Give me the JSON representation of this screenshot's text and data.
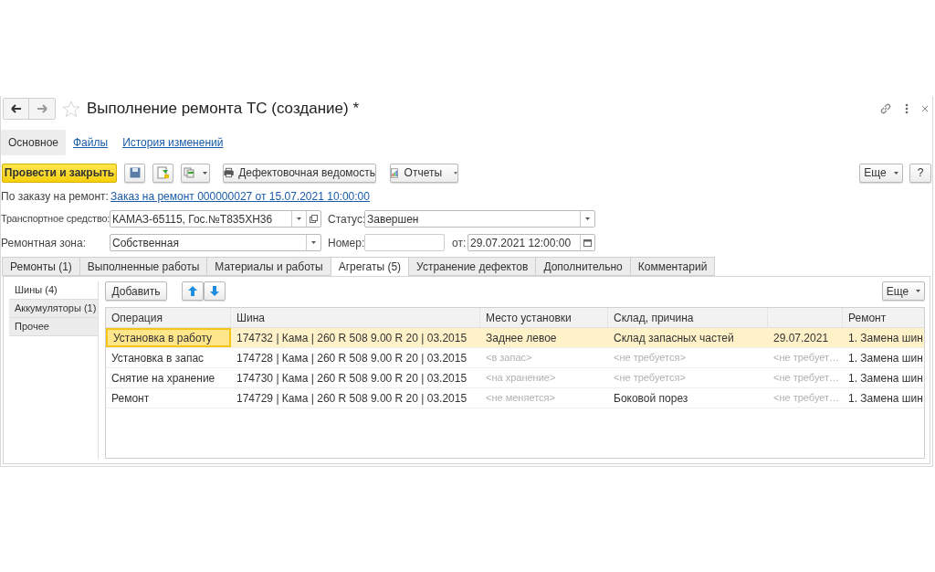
{
  "window": {
    "title": "Выполнение ремонта ТС (создание) *"
  },
  "nav_tabs": [
    {
      "label": "Основное",
      "selected": true
    },
    {
      "label": "Файлы",
      "selected": false
    },
    {
      "label": "История изменений",
      "selected": false
    }
  ],
  "toolbar": {
    "post_button": "Провести и закрыть",
    "print_button": "Дефектовочная ведомость",
    "reports_button": "Отчеты",
    "more_button": "Еще",
    "help_button": "?"
  },
  "order": {
    "label": "По заказу на ремонт:",
    "link": "Заказ на ремонт 000000027 от 15.07.2021 10:00:00"
  },
  "vehicle": {
    "label": "Транспортное средство:",
    "value": "КАМАЗ-65115, Гос.№Т835ХН36"
  },
  "status": {
    "label": "Статус:",
    "value": "Завершен"
  },
  "zone": {
    "label": "Ремонтная зона:",
    "value": "Собственная"
  },
  "number": {
    "label": "Номер:"
  },
  "date": {
    "label": "от:",
    "value": "29.07.2021 12:00:00"
  },
  "tabs": [
    {
      "label": "Ремонты (1)",
      "selected": false
    },
    {
      "label": "Выполненные работы",
      "selected": false
    },
    {
      "label": "Материалы и работы",
      "selected": false
    },
    {
      "label": "Агрегаты (5)",
      "selected": true
    },
    {
      "label": "Устранение дефектов",
      "selected": false
    },
    {
      "label": "Дополнительно",
      "selected": false
    },
    {
      "label": "Комментарий",
      "selected": false
    }
  ],
  "side_tabs": [
    {
      "label": "Шины (4)",
      "selected": true
    },
    {
      "label": "Аккумуляторы (1)",
      "selected": false
    },
    {
      "label": "Прочее",
      "selected": false
    }
  ],
  "table_toolbar": {
    "add_button": "Добавить",
    "more_button": "Еще"
  },
  "table": {
    "columns": [
      "Операция",
      "Шина",
      "Место установки",
      "Склад, причина",
      "",
      "Ремонт"
    ],
    "rows": [
      {
        "selected": true,
        "cells": [
          {
            "text": "Установка в работу",
            "muted": false
          },
          {
            "text": "174732 | Кама | 260 R 508 9.00 R 20 | 03.2015",
            "muted": false
          },
          {
            "text": "Заднее левое",
            "muted": false
          },
          {
            "text": "Склад запасных частей",
            "muted": false
          },
          {
            "text": "29.07.2021",
            "muted": false
          },
          {
            "text": "1. Замена шин",
            "muted": false
          }
        ]
      },
      {
        "selected": false,
        "cells": [
          {
            "text": "Установка в запас",
            "muted": false
          },
          {
            "text": "174728 | Кама | 260 R 508 9.00 R 20 | 03.2015",
            "muted": false
          },
          {
            "text": "<в запас>",
            "muted": true
          },
          {
            "text": "<не требуется>",
            "muted": true
          },
          {
            "text": "<не требует…",
            "muted": true
          },
          {
            "text": "1. Замена шин",
            "muted": false
          }
        ]
      },
      {
        "selected": false,
        "cells": [
          {
            "text": "Снятие на хранение",
            "muted": false
          },
          {
            "text": "174730 | Кама | 260 R 508 9.00 R 20 | 03.2015",
            "muted": false
          },
          {
            "text": "<на хранение>",
            "muted": true
          },
          {
            "text": "<не требуется>",
            "muted": true
          },
          {
            "text": "<не требует…",
            "muted": true
          },
          {
            "text": "1. Замена шин",
            "muted": false
          }
        ]
      },
      {
        "selected": false,
        "cells": [
          {
            "text": "Ремонт",
            "muted": false
          },
          {
            "text": "174729 | Кама | 260 R 508 9.00 R 20 | 03.2015",
            "muted": false
          },
          {
            "text": "<не меняется>",
            "muted": true
          },
          {
            "text": "Боковой порез",
            "muted": false
          },
          {
            "text": "<не требует…",
            "muted": true
          },
          {
            "text": "1. Замена шин",
            "muted": false
          }
        ]
      }
    ]
  }
}
